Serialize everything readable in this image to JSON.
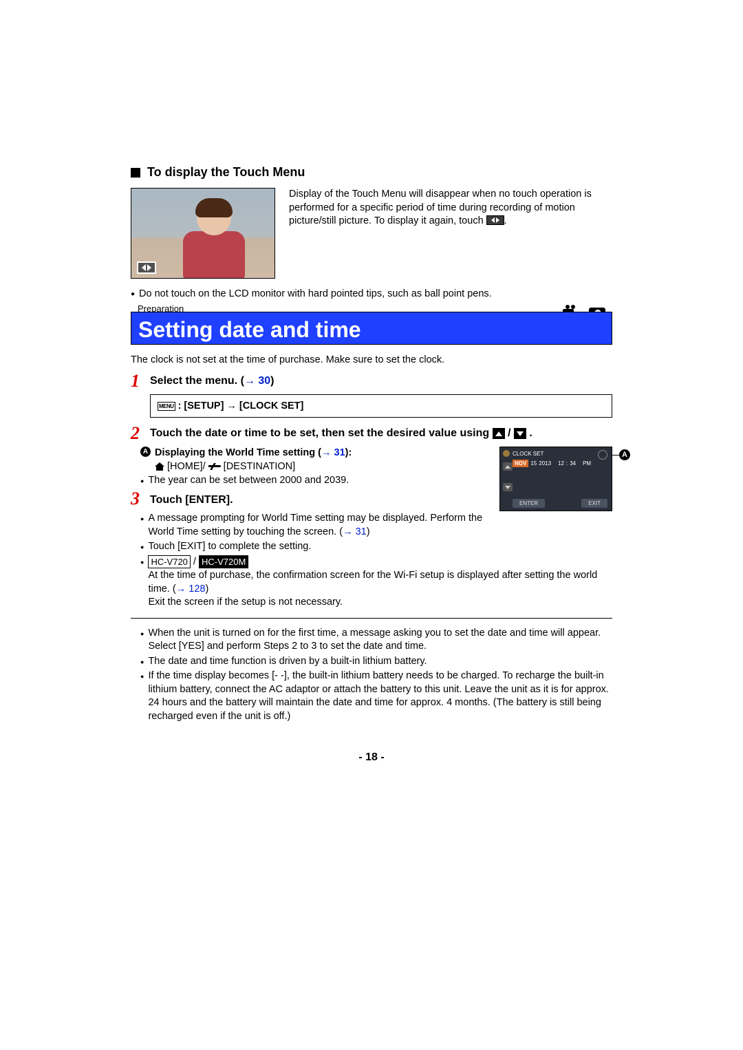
{
  "section1": {
    "heading": "To display the Touch Menu",
    "paragraph_prefix": "Display of the Touch Menu will disappear when no touch operation is performed for a specific period of time during recording of motion picture/still picture. To display it again, touch ",
    "paragraph_suffix": ".",
    "warning": "Do not touch on the LCD monitor with hard pointed tips, such as ball point pens."
  },
  "header": {
    "category": "Preparation",
    "title": "Setting date and time"
  },
  "intro": "The clock is not set at the time of purchase. Make sure to set the clock.",
  "step1": {
    "num": "1",
    "text_prefix": "Select the menu. (",
    "link": "30",
    "text_suffix": ")",
    "menu_label": "MENU",
    "menu_colon": ": [SETUP] ",
    "menu_arrow": "→",
    "menu_after": " [CLOCK SET]"
  },
  "step2": {
    "num": "2",
    "text": "Touch the date or time to be set, then set the desired value using ",
    "suffix": ".",
    "callout_letter": "A",
    "sub_bold_prefix": "Displaying the World Time setting (",
    "sub_link": "31",
    "sub_bold_suffix": "):",
    "home_label": " [HOME]/",
    "dest_label": " [DESTINATION]",
    "year_range": "The year can be set between 2000 and 2039.",
    "screen": {
      "title": "CLOCK SET",
      "nov": "NOV",
      "d": "15",
      "y": "2013",
      "h": "12",
      "sep": ":",
      "m": "34",
      "ampm": "PM",
      "enter": "ENTER",
      "exit": "EXIT"
    }
  },
  "step3": {
    "num": "3",
    "text": "Touch [ENTER].",
    "b1_prefix": "A message prompting for World Time setting may be displayed. Perform the World Time setting by touching the screen. (",
    "b1_link": "31",
    "b1_suffix": ")",
    "b2": "Touch [EXIT] to complete the setting.",
    "model1": "HC-V720",
    "model_sep": " / ",
    "model2": "HC-V720M",
    "b3a": "At the time of purchase, the confirmation screen for the Wi-Fi setup is displayed after setting the world time. (",
    "b3_link": "128",
    "b3b": ")",
    "b3c": "Exit the screen if the setup is not necessary."
  },
  "notes": {
    "n1": "When the unit is turned on for the first time, a message asking you to set the date and time will appear. Select [YES] and perform Steps 2 to 3 to set the date and time.",
    "n2": "The date and time function is driven by a built-in lithium battery.",
    "n3": "If the time display becomes [- -], the built-in lithium battery needs to be charged. To recharge the built-in lithium battery, connect the AC adaptor or attach the battery to this unit. Leave the unit as it is for approx. 24 hours and the battery will maintain the date and time for approx. 4 months. (The battery is still being recharged even if the unit is off.)"
  },
  "page_number": "- 18 -"
}
